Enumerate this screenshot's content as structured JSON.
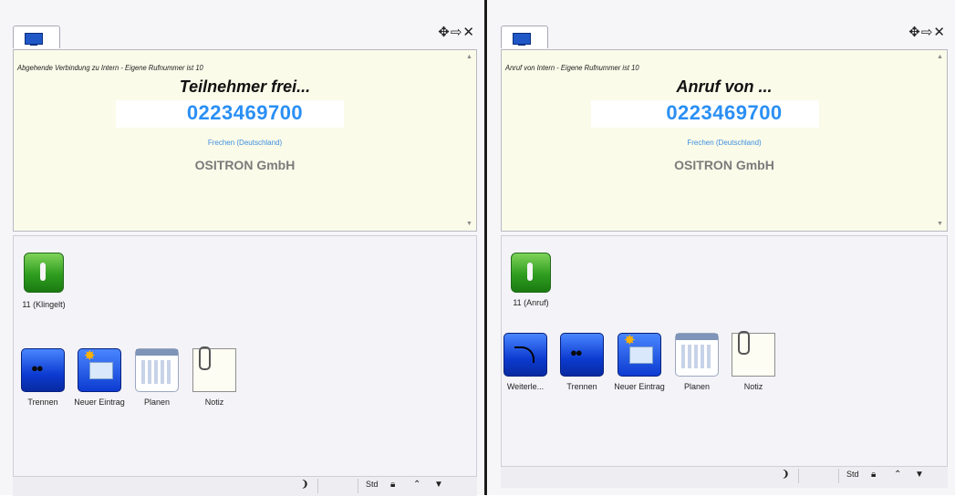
{
  "window_controls": {
    "move": "✥",
    "pin": "⇨",
    "close": "✕"
  },
  "left": {
    "status_line": "Abgehende Verbindung zu Intern - Eigene Rufnummer ist 10",
    "state": "Teilnehmer frei...",
    "number": "0223469700",
    "location": "Frechen (Deutschland)",
    "company": "OSITRON GmbH",
    "line_label": "11 (Klingelt)",
    "actions": [
      "Trennen",
      "Neuer Eintrag",
      "Planen",
      "Notiz"
    ],
    "status": {
      "hook": "❩",
      "mode": "Std"
    }
  },
  "right": {
    "status_line": "Anruf von Intern - Eigene Rufnummer ist 10",
    "state": "Anruf von ...",
    "number": "0223469700",
    "location": "Frechen (Deutschland)",
    "company": "OSITRON GmbH",
    "line_label": "11 (Anruf)",
    "actions": [
      "Weiterle...",
      "Trennen",
      "Neuer Eintrag",
      "Planen",
      "Notiz"
    ],
    "status": {
      "hook": "❩",
      "mode": "Std"
    }
  },
  "icons": {
    "screen": "screen-icon",
    "phone": "phone-handset-icon",
    "disconnect": "disconnect-icon",
    "forward": "forward-call-icon",
    "new_entry": "new-entry-icon",
    "calendar": "calendar-icon",
    "note": "note-icon",
    "lock": "lock-icon",
    "expand": "double-chevron-up-icon",
    "dropdown": "dropdown-arrow-icon"
  },
  "colors": {
    "number": "#2a8ff5",
    "info_bg": "#fafbe9",
    "company": "#7b7b7b",
    "call_button": "#2f9d1f"
  }
}
